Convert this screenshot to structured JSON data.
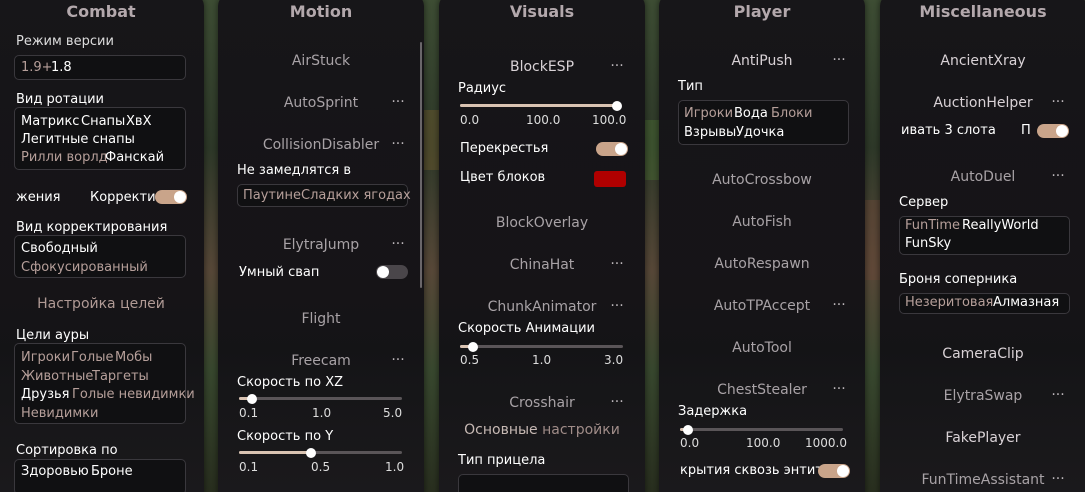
{
  "colors": {
    "accent": "#d9c3b2",
    "toggle_on": "#c9a48a",
    "color_swatch": "#b00000"
  },
  "combat": {
    "title": "Combat",
    "version_label": "Режим версии",
    "version_opts": [
      "1.9+",
      "1.8"
    ],
    "rot_label": "Вид ротации",
    "rot_opts": [
      "Матрикс",
      "Снапы",
      "ХвХ",
      "Легитные снапы",
      "Рилли ворлд",
      "Фанскай"
    ],
    "corr_left": "жения",
    "corr_right": "Корректи",
    "corr_type_label": "Вид корректирования",
    "corr_type_opts": [
      "Свободный",
      "Сфокусированный"
    ],
    "targets_section": "Настройка целей",
    "aura_label": "Цели ауры",
    "aura_opts": [
      "Игроки",
      "Голые",
      "Мобы",
      "Животные",
      "Таргеты",
      "Друзья",
      "Голые невидимки",
      "Невидимки"
    ],
    "sort_label": "Сортировка по",
    "sort_opts": [
      "Здоровью",
      "Броне"
    ]
  },
  "motion": {
    "title": "Motion",
    "mods": [
      "AirStuck",
      "AutoSprint",
      "CollisionDisabler",
      "ElytraJump",
      "Flight",
      "Freecam"
    ],
    "slow_label": "Не замедлятся в",
    "slow_opts": [
      "Паутине",
      "Сладких ягодах"
    ],
    "smart_label": "Умный свап",
    "xz_label": "Скорость по XZ",
    "xz_ticks": [
      "0.1",
      "1.0",
      "5.0"
    ],
    "xz_value": 0.5,
    "y_label": "Скорость по Y",
    "y_ticks": [
      "0.1",
      "0.5",
      "1.0"
    ],
    "y_value": 0.5
  },
  "visuals": {
    "title": "Visuals",
    "mods": [
      "BlockESP",
      "BlockOverlay",
      "ChinaHat",
      "ChunkAnimator",
      "Crosshair"
    ],
    "radius_label": "Радиус",
    "radius_ticks": [
      "0.0",
      "100.0",
      "100.0"
    ],
    "radius_value": 100.0,
    "cross_label": "Перекрестья",
    "blockcolor_label": "Цвет блоков",
    "anim_label": "Скорость Анимации",
    "anim_ticks": [
      "0.5",
      "1.0",
      "3.0"
    ],
    "anim_value": 0.7,
    "main_section_a": "Основные",
    "main_section_b": "настройки",
    "crosshair_type_label": "Тип прицела"
  },
  "player": {
    "title": "Player",
    "mods": [
      "AntiPush",
      "AutoCrossbow",
      "AutoFish",
      "AutoRespawn",
      "AutoTPAccept",
      "AutoTool",
      "ChestStealer"
    ],
    "type_label": "Тип",
    "type_opts": [
      "Игроки",
      "Вода",
      "Блоки",
      "Взрывы",
      "Удочка"
    ],
    "delay_label": "Задержка",
    "delay_ticks": [
      "0.0",
      "100.0",
      "1000.0"
    ],
    "delay_value": 50.0,
    "through_label": "крытия сквозь энтит"
  },
  "misc": {
    "title": "Miscellaneous",
    "mods": [
      "AncientXray",
      "AuctionHelper",
      "AutoDuel",
      "CameraClip",
      "ElytraSwap",
      "FakePlayer",
      "FunTimeAssistant"
    ],
    "slot_left": "ивать 3 слота",
    "slot_right": "П",
    "server_label": "Сервер",
    "server_opts": [
      "FunTime",
      "ReallyWorld",
      "FunSky"
    ],
    "armor_label": "Броня соперника",
    "armor_opts": [
      "Незеритовая",
      "Алмазная"
    ]
  },
  "icons": {
    "more": "more-dots-icon"
  },
  "dots_glyph": "···"
}
